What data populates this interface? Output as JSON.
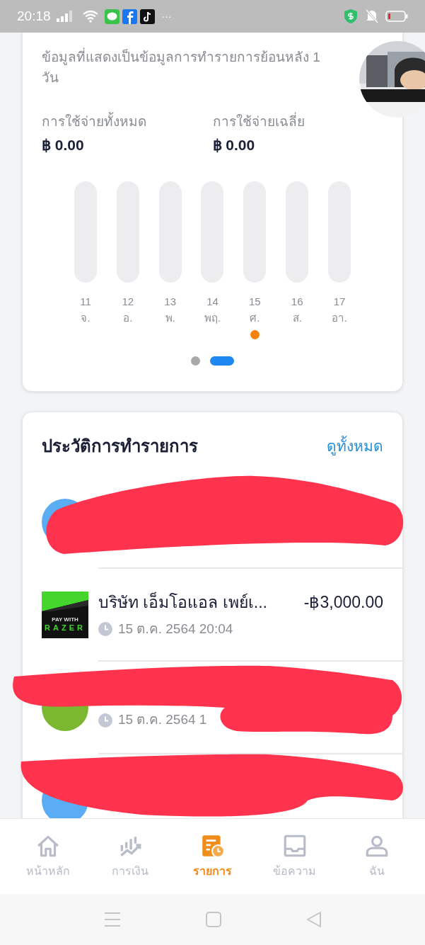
{
  "status_bar": {
    "time": "20:18",
    "more": "···"
  },
  "spending_card": {
    "description": "ข้อมูลที่แสดงเป็นข้อมูลการทำรายการย้อนหลัง 1 วัน",
    "stats": [
      {
        "label": "การใช้จ่ายทั้งหมด",
        "value": "฿ 0.00"
      },
      {
        "label": "การใช้จ่ายเฉลี่ย",
        "value": "฿ 0.00"
      }
    ],
    "days": [
      {
        "day": "11",
        "weekday": "จ.",
        "selected": false
      },
      {
        "day": "12",
        "weekday": "อ.",
        "selected": false
      },
      {
        "day": "13",
        "weekday": "พ.",
        "selected": false
      },
      {
        "day": "14",
        "weekday": "พฤ.",
        "selected": false
      },
      {
        "day": "15",
        "weekday": "ศ.",
        "selected": true
      },
      {
        "day": "16",
        "weekday": "ส.",
        "selected": false
      },
      {
        "day": "17",
        "weekday": "อา.",
        "selected": false
      }
    ],
    "pages": [
      {
        "selected": false
      },
      {
        "selected": true
      }
    ]
  },
  "history_card": {
    "title": "ประวัติการทำรายการ",
    "link": "ดูทั้งหมด",
    "transactions": [
      {
        "kind": "avatar",
        "color": "#5aacf5"
      },
      {
        "kind": "logo",
        "logo_lines": [
          "PAY WITH",
          "RAZER"
        ],
        "name": "บริษัท เอ็มโอแอล เพย์เ...",
        "amount": "-฿3,000.00",
        "time": "15 ต.ค. 2564 20:04"
      },
      {
        "kind": "avatar",
        "color": "#7cb82f",
        "time": "15 ต.ค. 2564 1"
      },
      {
        "kind": "avatar",
        "color": "#5aacf5"
      }
    ]
  },
  "bottom_nav": [
    {
      "label": "หน้าหลัก",
      "selected": false
    },
    {
      "label": "การเงิน",
      "selected": false
    },
    {
      "label": "รายการ",
      "selected": true
    },
    {
      "label": "ข้อความ",
      "selected": false
    },
    {
      "label": "ฉัน",
      "selected": false
    }
  ]
}
